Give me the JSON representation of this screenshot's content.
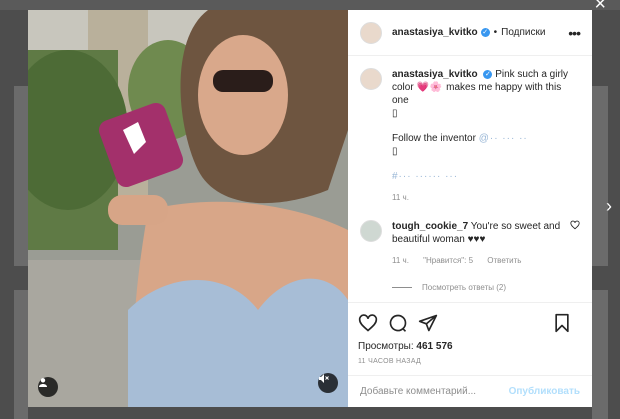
{
  "window": {
    "close_glyph": "×",
    "next_arrow": "›"
  },
  "post": {
    "username": "anastasiya_kvitko",
    "verified_glyph": "✓",
    "dot": "•",
    "follow_label": "Подписки",
    "more_glyph": "•••"
  },
  "caption": {
    "username": "anastasiya_kvitko",
    "text_a": "Pink such a girly color",
    "text_a_blur": "💗🌸",
    "text_b": " makes me happy with this one",
    "emoji_a": "▯",
    "follow_text": "Follow the inventor",
    "follow_blur": "@·· ··· ··",
    "emoji_b": "▯",
    "hashtags_blur": "#··· ······ ···",
    "time": "11 ч."
  },
  "comment": {
    "username": "tough_cookie_7",
    "text": "You're so sweet and beautiful woman ♥♥♥",
    "time": "11 ч.",
    "likes": "\"Нравится\": 5",
    "reply": "Ответить",
    "view_replies": "Посмотреть ответы (2)"
  },
  "stats": {
    "views_label": "Просмотры:",
    "views_count": "461 576",
    "time_ago": "11 ЧАСОВ НАЗАД"
  },
  "add_comment": {
    "placeholder": "Добавьте комментарий...",
    "publish_label": "Опубликовать"
  },
  "colors": {
    "accent": "#3897f0",
    "publish_disabled": "#b2dffc"
  }
}
